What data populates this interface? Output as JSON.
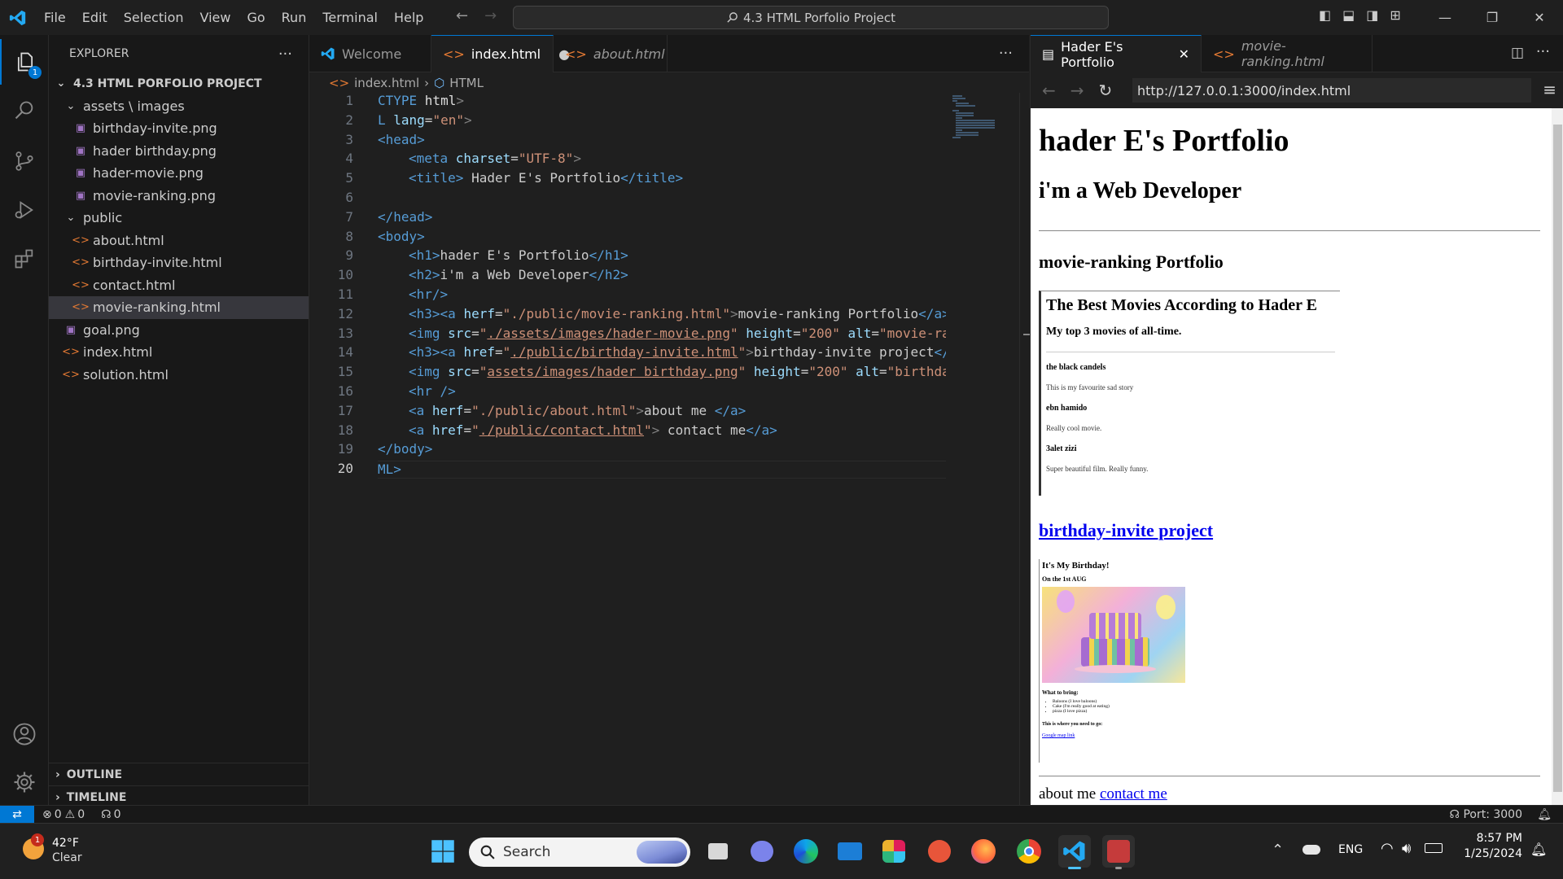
{
  "titlebar": {
    "menu": [
      "File",
      "Edit",
      "Selection",
      "View",
      "Go",
      "Run",
      "Terminal",
      "Help"
    ],
    "command_center": "4.3 HTML Porfolio Project"
  },
  "activity": {
    "explorer_badge": "1"
  },
  "sidebar": {
    "title": "EXPLORER",
    "project": "4.3 HTML PORFOLIO PROJECT",
    "tree": [
      {
        "label": "assets \\ images",
        "kind": "folder",
        "depth": 1
      },
      {
        "label": "birthday-invite.png",
        "kind": "image",
        "depth": 2
      },
      {
        "label": "hader birthday.png",
        "kind": "image",
        "depth": 2
      },
      {
        "label": "hader-movie.png",
        "kind": "image",
        "depth": 2
      },
      {
        "label": "movie-ranking.png",
        "kind": "image",
        "depth": 2
      },
      {
        "label": "public",
        "kind": "folder",
        "depth": 1
      },
      {
        "label": "about.html",
        "kind": "html",
        "depth": 2
      },
      {
        "label": "birthday-invite.html",
        "kind": "html",
        "depth": 2
      },
      {
        "label": "contact.html",
        "kind": "html",
        "depth": 2
      },
      {
        "label": "movie-ranking.html",
        "kind": "html",
        "depth": 2,
        "selected": true
      },
      {
        "label": "goal.png",
        "kind": "image",
        "depth": 1
      },
      {
        "label": "index.html",
        "kind": "html",
        "depth": 1
      },
      {
        "label": "solution.html",
        "kind": "html",
        "depth": 1
      }
    ],
    "outline": "OUTLINE",
    "timeline": "TIMELINE"
  },
  "editor": {
    "tabs": [
      {
        "label": "Welcome"
      },
      {
        "label": "index.html"
      },
      {
        "label": "about.html"
      }
    ],
    "breadcrumb_file": "index.html",
    "breadcrumb_node": "HTML",
    "lines": [
      "1",
      "2",
      "3",
      "4",
      "5",
      "6",
      "7",
      "8",
      "9",
      "10",
      "11",
      "12",
      "13",
      "14",
      "15",
      "16",
      "17",
      "18",
      "19",
      "20"
    ],
    "code": {
      "l1a": "CTYPE ",
      "l1b": "html",
      "l1c": ">",
      "l2a": "L ",
      "l2b": "lang",
      "l2c": "=",
      "l2d": "\"en\"",
      "l2e": ">",
      "l3": "<head>",
      "l4a": "<meta ",
      "l4b": "charset",
      "l4c": "=",
      "l4d": "\"UTF-8\"",
      "l4e": ">",
      "l5a": "<title>",
      "l5b": " Hader E's Portfolio",
      "l5c": "</title>",
      "l7": "</head>",
      "l8": "<body>",
      "l9a": "<h1>",
      "l9b": "hader E's Portfolio",
      "l9c": "</h1>",
      "l10a": "<h2>",
      "l10b": "i'm a Web Developer",
      "l10c": "</h2>",
      "l11": "<hr/>",
      "l12a": "<h3><a ",
      "l12b": "herf",
      "l12c": "=",
      "l12d": "\"./public/movie-ranking.html\"",
      "l12e": ">",
      "l12f": "movie-ranking Portfolio",
      "l12g": "</a>",
      "l13a": "<img ",
      "l13b": "src",
      "l13c": "=",
      "l13d": "\"",
      "l13e": "./assets/images/hader-movie.png",
      "l13f": "\"",
      "l13g": " height",
      "l13h": "=",
      "l13i": "\"200\"",
      "l13j": " alt",
      "l13k": "=",
      "l13l": "\"movie-ra",
      "l14a": "<h3><a ",
      "l14b": "href",
      "l14c": "=",
      "l14d": "\"",
      "l14e": "./public/birthday-invite.html",
      "l14f": "\"",
      "l14g": ">",
      "l14h": "birthday-invite project",
      "l14i": "</",
      "l15a": "<img ",
      "l15b": "src",
      "l15c": "=",
      "l15d": "\"",
      "l15e": "assets/images/hader birthday.png",
      "l15f": "\"",
      "l15g": " height",
      "l15h": "=",
      "l15i": "\"200\"",
      "l15j": " alt",
      "l15k": "=",
      "l15l": "\"birthda",
      "l16": "<hr />",
      "l17a": "<a ",
      "l17b": "herf",
      "l17c": "=",
      "l17d": "\"./public/about.html\"",
      "l17e": ">",
      "l17f": "about me ",
      "l17g": "</a>",
      "l18a": "<a ",
      "l18b": "href",
      "l18c": "=",
      "l18d": "\"",
      "l18e": "./public/contact.html",
      "l18f": "\"",
      "l18g": ">",
      "l18h": " contact me",
      "l18i": "</a>",
      "l19": "</body>",
      "l20": "ML>"
    }
  },
  "browser": {
    "tabs": [
      {
        "label": "Hader E's Portfolio"
      },
      {
        "label": "movie-ranking.html"
      }
    ],
    "url": "http://127.0.0.1:3000/index.html",
    "page": {
      "h1": "hader E's Portfolio",
      "h2": "i'm a Web Developer",
      "h3": "movie-ranking Portfolio",
      "movie_title": "The Best Movies According to Hader E",
      "movie_sub": "My top 3 movies of all-time.",
      "movies": [
        {
          "name": "the black candels",
          "desc": "This is my favourite sad story"
        },
        {
          "name": "ebn hamido",
          "desc": "Really cool movie."
        },
        {
          "name": "3alet zizi",
          "desc": "Super beautiful film. Really funny."
        }
      ],
      "birthday_link": "birthday-invite project",
      "bday_title": "It's My Birthday!",
      "bday_date": "On the 1st AUG",
      "bday_bring": "What to bring:",
      "bday_items": [
        "Baloons (I love baloons)",
        "Cake (I'm really good at eating)",
        "pizza (I love pizza)"
      ],
      "bday_where": "This is where you need to go:",
      "bday_link": "Google map link",
      "about": "about me",
      "contact": "contact me"
    }
  },
  "status": {
    "errors": "0",
    "warnings": "0",
    "ports": "0",
    "port": "Port: 3000"
  },
  "taskbar": {
    "weather_badge": "1",
    "temp": "42°F",
    "cond": "Clear",
    "search": "Search",
    "lang": "ENG",
    "time": "8:57 PM",
    "date": "1/25/2024"
  }
}
